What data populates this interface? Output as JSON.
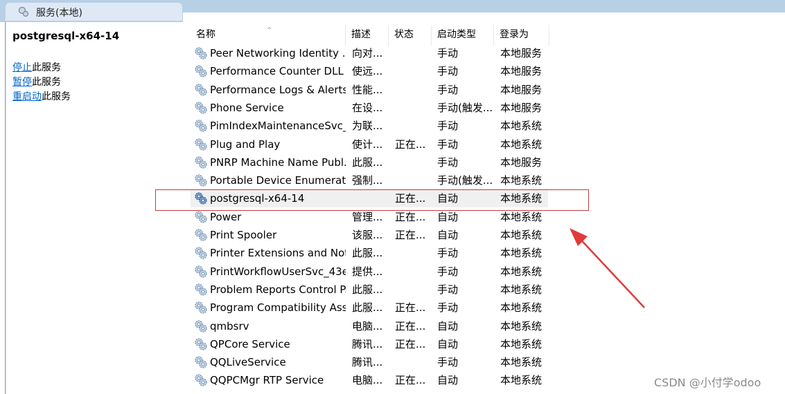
{
  "window": {
    "title": "服务(本地)"
  },
  "left_pane": {
    "service_name": "postgresql-x64-14",
    "actions": [
      {
        "link": "停止",
        "suffix": "此服务"
      },
      {
        "link": "暂停",
        "suffix": "此服务"
      },
      {
        "link": "重启动",
        "suffix": "此服务"
      }
    ]
  },
  "columns": {
    "name": "名称",
    "desc": "描述",
    "status": "状态",
    "startup": "启动类型",
    "logon": "登录为"
  },
  "rows": [
    {
      "name": "Peer Networking Identity ...",
      "desc": "向对...",
      "status": "",
      "startup": "手动",
      "logon": "本地服务"
    },
    {
      "name": "Performance Counter DLL ...",
      "desc": "使远...",
      "status": "",
      "startup": "手动",
      "logon": "本地服务"
    },
    {
      "name": "Performance Logs & Alerts",
      "desc": "性能...",
      "status": "",
      "startup": "手动",
      "logon": "本地服务"
    },
    {
      "name": "Phone Service",
      "desc": "在设...",
      "status": "",
      "startup": "手动(触发...",
      "logon": "本地服务"
    },
    {
      "name": "PimIndexMaintenanceSvc_...",
      "desc": "为联...",
      "status": "",
      "startup": "手动",
      "logon": "本地系统"
    },
    {
      "name": "Plug and Play",
      "desc": "使计...",
      "status": "正在...",
      "startup": "手动",
      "logon": "本地系统"
    },
    {
      "name": "PNRP Machine Name Publ...",
      "desc": "此服...",
      "status": "",
      "startup": "手动",
      "logon": "本地服务"
    },
    {
      "name": "Portable Device Enumerat...",
      "desc": "强制...",
      "status": "",
      "startup": "手动(触发...",
      "logon": "本地系统"
    },
    {
      "name": "postgresql-x64-14",
      "desc": "",
      "status": "正在...",
      "startup": "自动",
      "logon": "本地系统"
    },
    {
      "name": "Power",
      "desc": "管理...",
      "status": "正在...",
      "startup": "自动",
      "logon": "本地系统"
    },
    {
      "name": "Print Spooler",
      "desc": "该服...",
      "status": "正在...",
      "startup": "自动",
      "logon": "本地系统"
    },
    {
      "name": "Printer Extensions and Noti...",
      "desc": "此服...",
      "status": "",
      "startup": "手动",
      "logon": "本地系统"
    },
    {
      "name": "PrintWorkflowUserSvc_43e...",
      "desc": "提供...",
      "status": "",
      "startup": "手动",
      "logon": "本地系统"
    },
    {
      "name": "Problem Reports Control P...",
      "desc": "此服...",
      "status": "",
      "startup": "手动",
      "logon": "本地系统"
    },
    {
      "name": "Program Compatibility Assi...",
      "desc": "此服...",
      "status": "正在...",
      "startup": "手动",
      "logon": "本地系统"
    },
    {
      "name": "qmbsrv",
      "desc": "电脑...",
      "status": "正在...",
      "startup": "自动",
      "logon": "本地系统"
    },
    {
      "name": "QPCore Service",
      "desc": "腾讯...",
      "status": "正在...",
      "startup": "自动",
      "logon": "本地系统"
    },
    {
      "name": "QQLiveService",
      "desc": "腾讯...",
      "status": "",
      "startup": "手动",
      "logon": "本地系统"
    },
    {
      "name": "QQPCMgr RTP Service",
      "desc": "电脑...",
      "status": "正在...",
      "startup": "自动",
      "logon": "本地系统"
    }
  ],
  "watermark": "CSDN @小付学odoo",
  "colors": {
    "header": "#b8d0e6",
    "link": "#0066cc",
    "highlight": "#c8383c",
    "arrow": "#e03a3a"
  },
  "icons": {
    "row": "gear-icon",
    "header": "services-icon"
  }
}
